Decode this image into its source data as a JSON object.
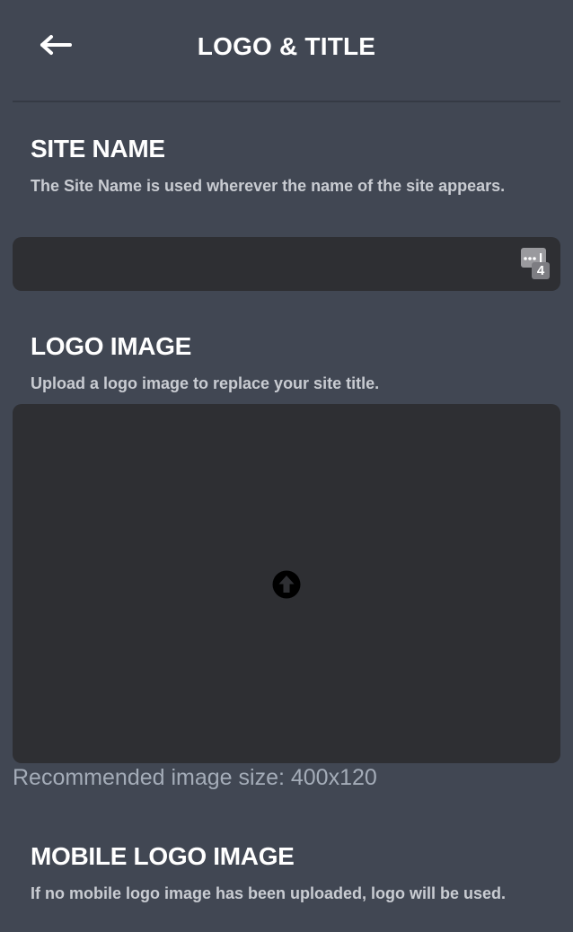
{
  "header": {
    "title": "LOGO & TITLE",
    "back_icon": "arrow-left-icon"
  },
  "site_name": {
    "title": "SITE NAME",
    "description": "The Site Name is used wherever the name of the site appears.",
    "value": "",
    "placeholder": "",
    "password_manager_badge": "4"
  },
  "logo_image": {
    "title": "LOGO IMAGE",
    "description": "Upload a logo image to replace your site title.",
    "upload_icon": "upload-arrow-icon",
    "hint": "Recommended image size: 400x120"
  },
  "mobile_logo_image": {
    "title": "MOBILE LOGO IMAGE",
    "description": "If no mobile logo image has been uploaded, logo will be used."
  }
}
